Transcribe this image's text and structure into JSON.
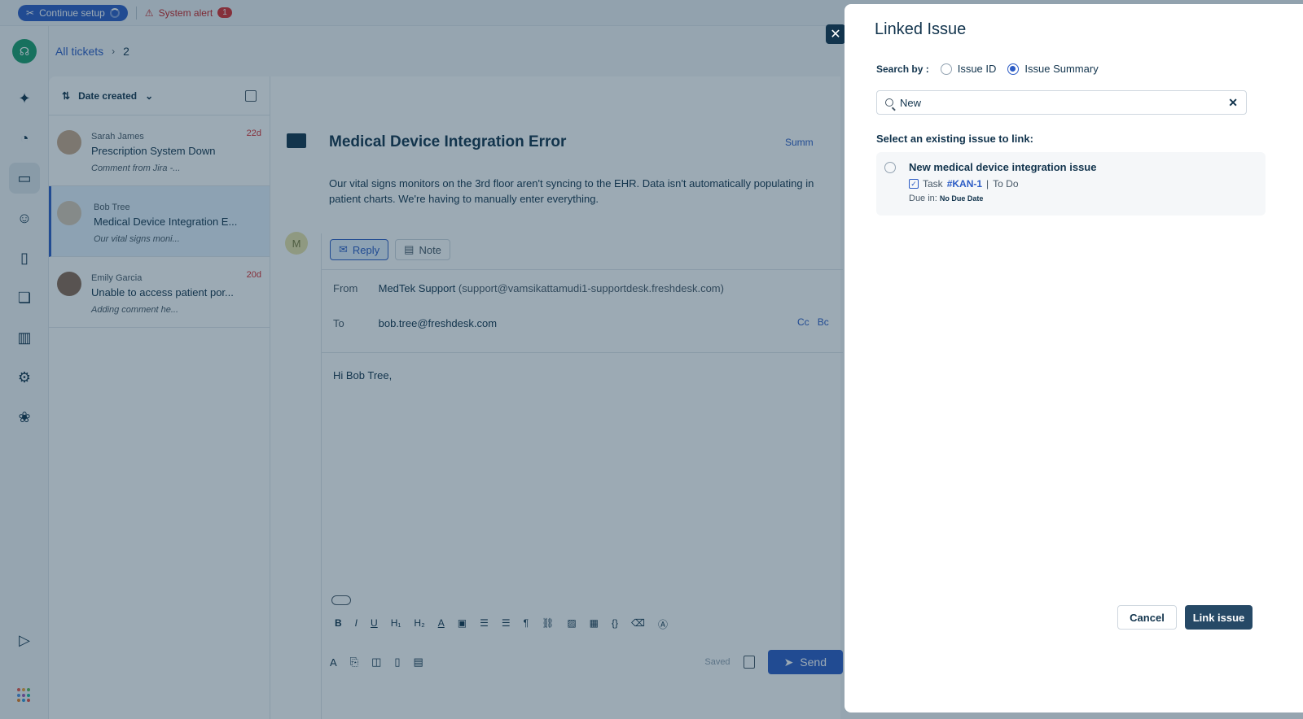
{
  "topbar": {
    "setup_label": "Continue setup",
    "alert_label": "System alert",
    "alert_count": "1"
  },
  "breadcrumb": {
    "root": "All tickets",
    "current": "2"
  },
  "ticket_list": {
    "sort_label": "Date created",
    "tickets": [
      {
        "requester": "Sarah James",
        "subject": "Prescription System Down",
        "preview": "Comment from Jira -...",
        "age": "22d"
      },
      {
        "requester": "Bob Tree",
        "subject": "Medical Device Integration E...",
        "preview": "Our vital signs moni...",
        "age": ""
      },
      {
        "requester": "Emily Garcia",
        "subject": "Unable to access patient por...",
        "preview": "Adding comment he...",
        "age": "20d"
      }
    ]
  },
  "ticket_detail": {
    "title": "Medical Device Integration Error",
    "summary_label": "Summ",
    "description": "Our vital signs monitors on the 3rd floor aren't syncing to the EHR. Data isn't automatically populating in patient charts. We're having to manually enter everything.",
    "agent_initial": "M"
  },
  "compose": {
    "reply_tab": "Reply",
    "note_tab": "Note",
    "from_label": "From",
    "from_name": "MedTek Support",
    "from_email": "(support@vamsikattamudi1-supportdesk.freshdesk.com)",
    "to_label": "To",
    "to_email": "bob.tree@freshdesk.com",
    "cc_label": "Cc",
    "bcc_label": "Bc",
    "body": "Hi Bob Tree,",
    "saved_label": "Saved",
    "send_label": "Send"
  },
  "modal": {
    "title": "Linked Issue",
    "search_by_label": "Search by :",
    "option_id": "Issue ID",
    "option_summary": "Issue Summary",
    "selected_option": "Issue Summary",
    "search_value": "New",
    "select_label": "Select an existing issue to link:",
    "issue": {
      "title": "New medical device integration issue",
      "type": "Task",
      "key": "#KAN-1",
      "status_sep": "|",
      "status": "To Do",
      "due_label": "Due in:",
      "due_value": "No Due Date"
    },
    "cancel_label": "Cancel",
    "link_label": "Link issue"
  },
  "colors": {
    "brand": "#2c5cc5",
    "primary_button": "#264966",
    "overlay": "#12344d",
    "alert": "#d72d30"
  },
  "icons": [
    "spark-icon",
    "dashboard-icon",
    "tickets-icon",
    "contacts-icon",
    "knowledge-base-icon",
    "discussions-icon",
    "reports-icon",
    "settings-icon",
    "apps-icon"
  ]
}
